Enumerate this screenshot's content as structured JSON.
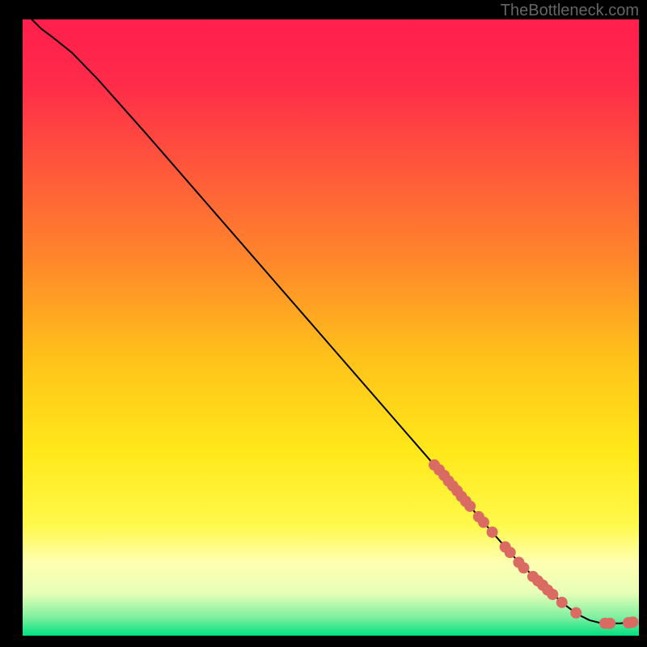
{
  "watermark": "TheBottleneck.com",
  "chart_data": {
    "type": "line",
    "title": "",
    "xlabel": "",
    "ylabel": "",
    "xlim": [
      0,
      100
    ],
    "ylim": [
      0,
      100
    ],
    "gradient_stops": [
      {
        "offset": 0.0,
        "color": "#ff1f4d"
      },
      {
        "offset": 0.1,
        "color": "#ff2a4a"
      },
      {
        "offset": 0.25,
        "color": "#ff5a3a"
      },
      {
        "offset": 0.4,
        "color": "#ff8a2a"
      },
      {
        "offset": 0.55,
        "color": "#ffc21a"
      },
      {
        "offset": 0.7,
        "color": "#ffe81a"
      },
      {
        "offset": 0.82,
        "color": "#fff94a"
      },
      {
        "offset": 0.88,
        "color": "#ffffb0"
      },
      {
        "offset": 0.93,
        "color": "#e8ffb8"
      },
      {
        "offset": 0.97,
        "color": "#80f0a0"
      },
      {
        "offset": 1.0,
        "color": "#00e080"
      }
    ],
    "curve_points": [
      {
        "x": 1.5,
        "y": 100.0
      },
      {
        "x": 3.0,
        "y": 98.5
      },
      {
        "x": 5.0,
        "y": 97.0
      },
      {
        "x": 8.0,
        "y": 94.6
      },
      {
        "x": 12.0,
        "y": 90.5
      },
      {
        "x": 20.0,
        "y": 81.5
      },
      {
        "x": 30.0,
        "y": 70.0
      },
      {
        "x": 40.0,
        "y": 58.5
      },
      {
        "x": 50.0,
        "y": 47.0
      },
      {
        "x": 60.0,
        "y": 35.5
      },
      {
        "x": 70.0,
        "y": 24.0
      },
      {
        "x": 76.0,
        "y": 17.0
      },
      {
        "x": 80.0,
        "y": 12.5
      },
      {
        "x": 84.0,
        "y": 8.5
      },
      {
        "x": 88.0,
        "y": 5.0
      },
      {
        "x": 90.0,
        "y": 3.5
      },
      {
        "x": 92.0,
        "y": 2.5
      },
      {
        "x": 94.0,
        "y": 2.0
      },
      {
        "x": 97.0,
        "y": 2.0
      },
      {
        "x": 99.0,
        "y": 2.2
      }
    ],
    "marker_points": [
      {
        "x": 66.8,
        "y": 27.7
      },
      {
        "x": 67.6,
        "y": 26.9
      },
      {
        "x": 68.4,
        "y": 26.0
      },
      {
        "x": 69.1,
        "y": 25.1
      },
      {
        "x": 69.8,
        "y": 24.3
      },
      {
        "x": 70.5,
        "y": 23.5
      },
      {
        "x": 71.2,
        "y": 22.6
      },
      {
        "x": 71.9,
        "y": 21.8
      },
      {
        "x": 72.6,
        "y": 21.0
      },
      {
        "x": 74.0,
        "y": 19.3
      },
      {
        "x": 74.8,
        "y": 18.4
      },
      {
        "x": 76.2,
        "y": 16.8
      },
      {
        "x": 78.3,
        "y": 14.4
      },
      {
        "x": 79.1,
        "y": 13.5
      },
      {
        "x": 80.5,
        "y": 11.9
      },
      {
        "x": 81.3,
        "y": 11.0
      },
      {
        "x": 82.8,
        "y": 9.6
      },
      {
        "x": 83.6,
        "y": 8.9
      },
      {
        "x": 84.4,
        "y": 8.2
      },
      {
        "x": 85.2,
        "y": 7.4
      },
      {
        "x": 86.0,
        "y": 6.7
      },
      {
        "x": 87.5,
        "y": 5.4
      },
      {
        "x": 89.8,
        "y": 3.7
      },
      {
        "x": 94.5,
        "y": 2.0
      },
      {
        "x": 95.3,
        "y": 2.0
      },
      {
        "x": 98.3,
        "y": 2.1
      },
      {
        "x": 99.0,
        "y": 2.2
      }
    ],
    "marker_color": "#d96b63",
    "line_color": "#000000"
  }
}
